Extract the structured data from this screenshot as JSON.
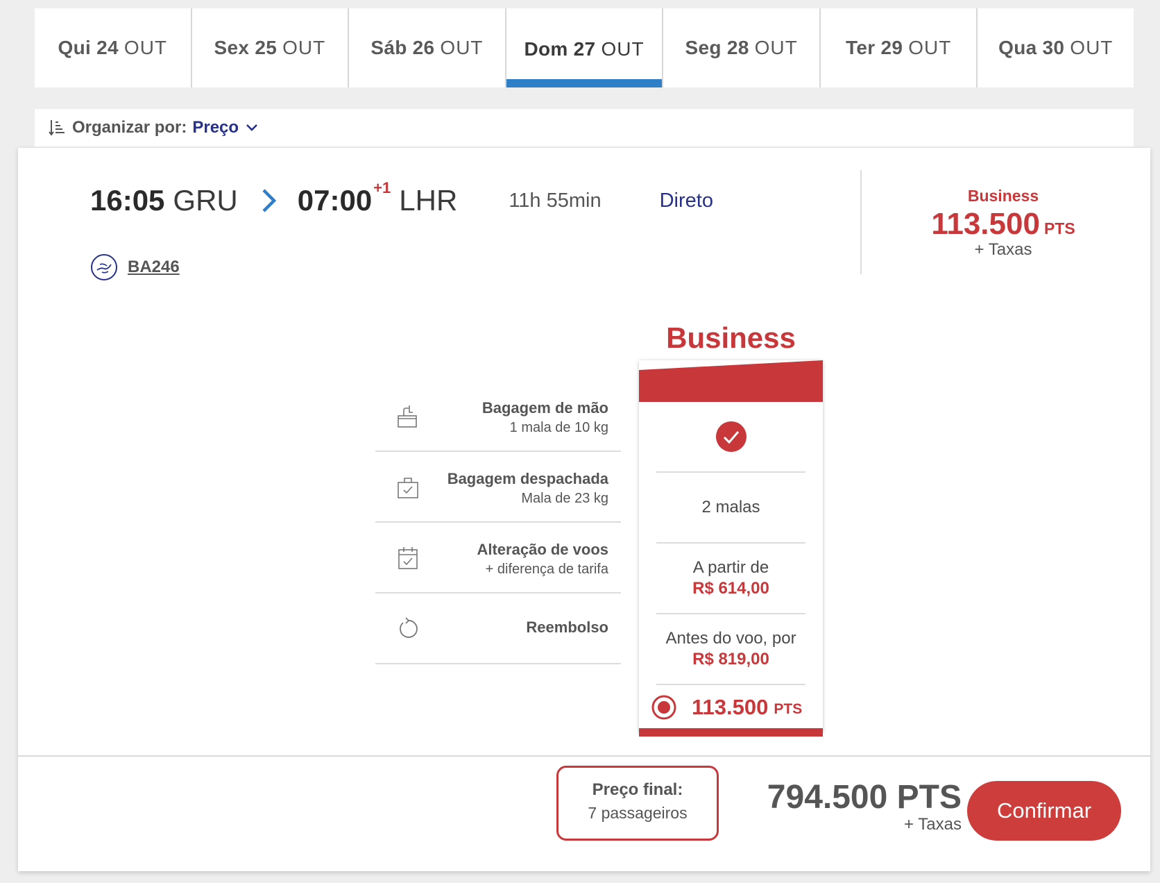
{
  "date_tabs": [
    {
      "day": "Qui 24",
      "month": "OUT",
      "active": false
    },
    {
      "day": "Sex 25",
      "month": "OUT",
      "active": false
    },
    {
      "day": "Sáb 26",
      "month": "OUT",
      "active": false
    },
    {
      "day": "Dom 27",
      "month": "OUT",
      "active": true
    },
    {
      "day": "Seg 28",
      "month": "OUT",
      "active": false
    },
    {
      "day": "Ter 29",
      "month": "OUT",
      "active": false
    },
    {
      "day": "Qua 30",
      "month": "OUT",
      "active": false
    }
  ],
  "sort": {
    "label": "Organizar por:",
    "value": "Preço",
    "icon": "sort-icon"
  },
  "flight": {
    "departure_time": "16:05",
    "departure_airport": "GRU",
    "arrival_time": "07:00",
    "day_offset": "+1",
    "arrival_airport": "LHR",
    "duration": "11h 55min",
    "stops": "Direto",
    "flight_number": "BA246"
  },
  "summary": {
    "cabin": "Business",
    "points": "113.500",
    "unit": "PTS",
    "taxes": "+ Taxas"
  },
  "features": [
    {
      "title": "Bagagem de mão",
      "subtitle": "1 mala de 10 kg",
      "icon": "carry-on-bag-icon"
    },
    {
      "title": "Bagagem despachada",
      "subtitle": "Mala de 23 kg",
      "icon": "checked-bag-icon"
    },
    {
      "title": "Alteração de voos",
      "subtitle": "+ diferença de tarifa",
      "icon": "calendar-change-icon"
    },
    {
      "title": "Reembolso",
      "subtitle": "",
      "icon": "refund-icon"
    }
  ],
  "fare": {
    "name": "Business",
    "carry_on": "included",
    "checked_bags": "2 malas",
    "change_prefix": "A partir de",
    "change_price": "R$ 614,00",
    "refund_prefix": "Antes do voo, por",
    "refund_price": "R$ 819,00",
    "points": "113.500",
    "unit": "PTS",
    "selected": true
  },
  "footer": {
    "final_label": "Preço final:",
    "passengers": "7 passageiros",
    "total_points": "794.500 PTS",
    "taxes": "+ Taxas",
    "confirm_label": "Confirmar"
  },
  "colors": {
    "accent_red": "#c8373a",
    "tab_active_blue": "#2e7fc8",
    "link_navy": "#27318b"
  }
}
